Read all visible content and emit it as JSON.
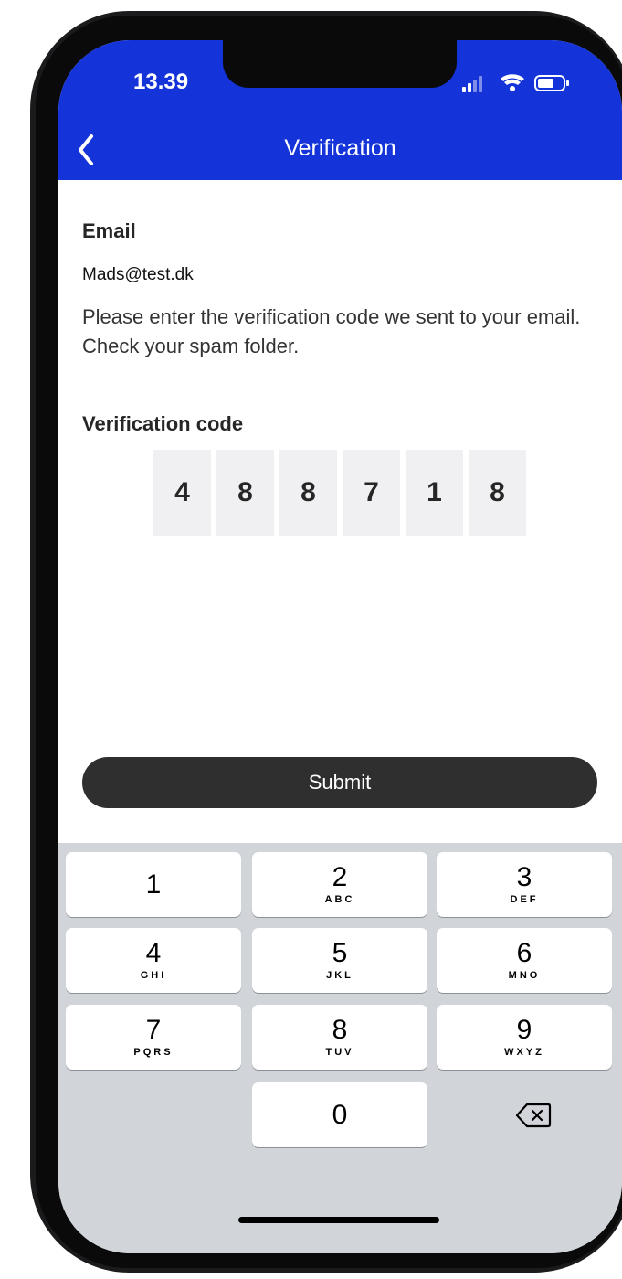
{
  "status_bar": {
    "time": "13.39"
  },
  "nav": {
    "title": "Verification"
  },
  "email": {
    "label": "Email",
    "value": "Mads@test.dk"
  },
  "instruction": "Please enter the verification code we sent to your email. Check your spam folder.",
  "code": {
    "label": "Verification code",
    "digits": [
      "4",
      "8",
      "8",
      "7",
      "1",
      "8"
    ]
  },
  "submit_label": "Submit",
  "keyboard": {
    "keys": [
      {
        "digit": "1",
        "letters": ""
      },
      {
        "digit": "2",
        "letters": "ABC"
      },
      {
        "digit": "3",
        "letters": "DEF"
      },
      {
        "digit": "4",
        "letters": "GHI"
      },
      {
        "digit": "5",
        "letters": "JKL"
      },
      {
        "digit": "6",
        "letters": "MNO"
      },
      {
        "digit": "7",
        "letters": "PQRS"
      },
      {
        "digit": "8",
        "letters": "TUV"
      },
      {
        "digit": "9",
        "letters": "WXYZ"
      },
      {
        "digit": "0",
        "letters": ""
      }
    ],
    "delete_icon": "backspace-icon"
  },
  "colors": {
    "header": "#1434d9",
    "submit": "#2f2f2f",
    "keyboard_bg": "#d1d4d9",
    "code_box": "#f0f0f2"
  }
}
